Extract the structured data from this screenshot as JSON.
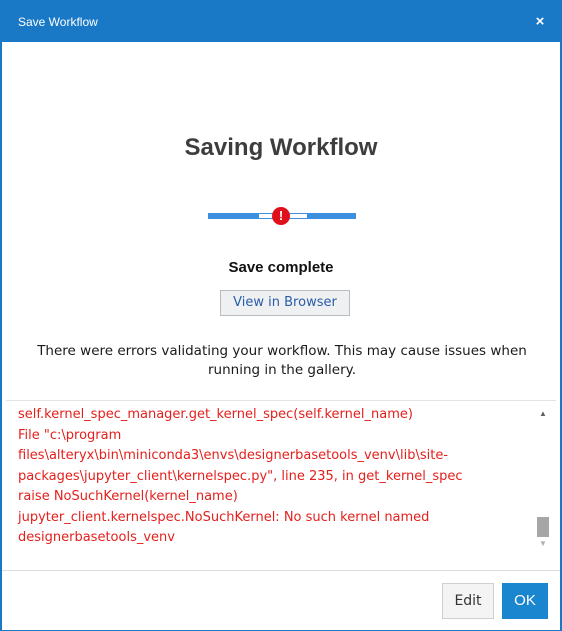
{
  "window": {
    "title": "Save Workflow",
    "close_glyph": "×"
  },
  "main": {
    "heading": "Saving Workflow",
    "error_glyph": "!",
    "status": "Save complete",
    "view_button_label": "View in Browser",
    "message": "There were errors validating your workflow. This may cause issues when running in the gallery."
  },
  "log": {
    "lines": [
      "self.kernel_spec_manager.get_kernel_spec(self.kernel_name)",
      "File \"c:\\program",
      "files\\alteryx\\bin\\miniconda3\\envs\\designerbasetools_venv\\lib\\site-",
      "packages\\jupyter_client\\kernelspec.py\", line 235, in get_kernel_spec",
      "raise NoSuchKernel(kernel_name)",
      "jupyter_client.kernelspec.NoSuchKernel: No such kernel named",
      "designerbasetools_venv"
    ]
  },
  "footer": {
    "edit_label": "Edit",
    "ok_label": "OK"
  },
  "colors": {
    "accent": "#1a79c7",
    "error_text": "#e4201d",
    "error_icon": "#e0101a"
  }
}
